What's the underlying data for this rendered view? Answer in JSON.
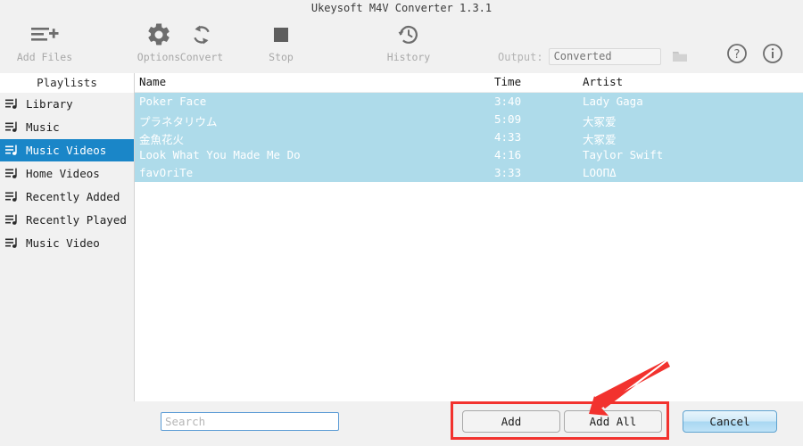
{
  "window": {
    "title": "Ukeysoft M4V Converter 1.3.1"
  },
  "toolbar": {
    "buttons": [
      {
        "label": "Add Files",
        "icon": "add-files-icon"
      },
      {
        "label": "Options",
        "icon": "gear-icon"
      },
      {
        "label": "Convert",
        "icon": "convert-refresh-icon"
      },
      {
        "label": "Stop",
        "icon": "stop-square-icon"
      },
      {
        "label": "History",
        "icon": "history-clock-icon"
      }
    ],
    "output_label": "Output:",
    "output_value": "Converted",
    "output_placeholder": "Converted",
    "folder_icon": "folder-icon",
    "help_icon": "question-circle-icon",
    "info_icon": "info-circle-icon"
  },
  "sidebar": {
    "header": "Playlists",
    "items": [
      {
        "label": "Library",
        "selected": false
      },
      {
        "label": "Music",
        "selected": false
      },
      {
        "label": "Music Videos",
        "selected": true
      },
      {
        "label": "Home Videos",
        "selected": false
      },
      {
        "label": "Recently Added",
        "selected": false
      },
      {
        "label": "Recently Played",
        "selected": false
      },
      {
        "label": "Music Video",
        "selected": false
      }
    ]
  },
  "list": {
    "columns": [
      "Name",
      "Time",
      "Artist"
    ],
    "rows": [
      {
        "name": "Poker Face",
        "time": "3:40",
        "artist": "Lady Gaga"
      },
      {
        "name": "プラネタリウム",
        "time": "5:09",
        "artist": "大冢爱"
      },
      {
        "name": "金魚花火",
        "time": "4:33",
        "artist": "大冢爱"
      },
      {
        "name": "Look What You Made Me Do",
        "time": "4:16",
        "artist": "Taylor Swift"
      },
      {
        "name": "favOriTe",
        "time": "3:33",
        "artist": "LOOΠΔ"
      }
    ]
  },
  "bottom": {
    "search_value": "",
    "search_placeholder": "Search",
    "add_label": "Add",
    "add_all_label": "Add All",
    "cancel_label": "Cancel"
  },
  "annotations": {
    "highlight_color": "#f2322e",
    "arrow_color": "#f2322e"
  },
  "colors": {
    "selection_blue": "#1a86c8",
    "row_highlight": "#aedbea",
    "background": "#f1f1f1"
  }
}
